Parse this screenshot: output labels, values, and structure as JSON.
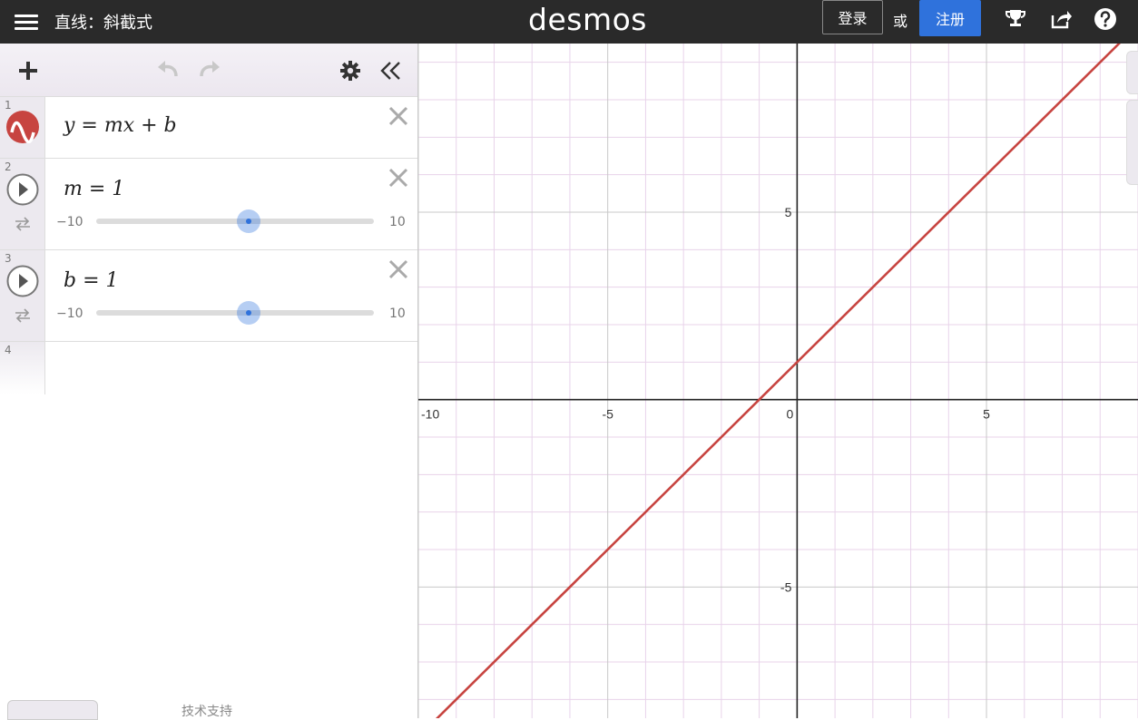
{
  "header": {
    "title": "直线：斜截式",
    "brand": "desmos",
    "login_label": "登录",
    "or_label": "或",
    "signup_label": "注册",
    "icons": [
      "menu-icon",
      "trophy-icon",
      "share-icon",
      "help-icon"
    ]
  },
  "toolbar": {
    "icons": [
      "add-icon",
      "undo-icon",
      "redo-icon",
      "settings-icon",
      "collapse-icon"
    ]
  },
  "expressions": [
    {
      "index": "1",
      "latex": "y = mx + b",
      "color": "#c74440"
    },
    {
      "index": "2",
      "latex": "m = 1",
      "slider": {
        "min": "−10",
        "max": "10",
        "value": 1
      }
    },
    {
      "index": "3",
      "latex": "b = 1",
      "slider": {
        "min": "−10",
        "max": "10",
        "value": 1
      }
    },
    {
      "index": "4",
      "latex": ""
    }
  ],
  "footer": {
    "powered_by": "技术支持"
  },
  "graph": {
    "x_ticks": [
      "-10",
      "-5",
      "0",
      "5"
    ],
    "y_ticks": [
      "5",
      "-5"
    ],
    "line_color": "#c74440",
    "axis_color": "#222222",
    "grid_major_color": "#c8c8c8",
    "grid_minor_color": "#e8d3ea"
  },
  "chart_data": {
    "type": "line",
    "series": [
      {
        "x": [
          -10,
          9
        ],
        "y": [
          -9,
          10
        ]
      }
    ],
    "xlim": [
      -10,
      9
    ],
    "ylim": [
      -8.5,
      9.5
    ],
    "grid": true
  }
}
